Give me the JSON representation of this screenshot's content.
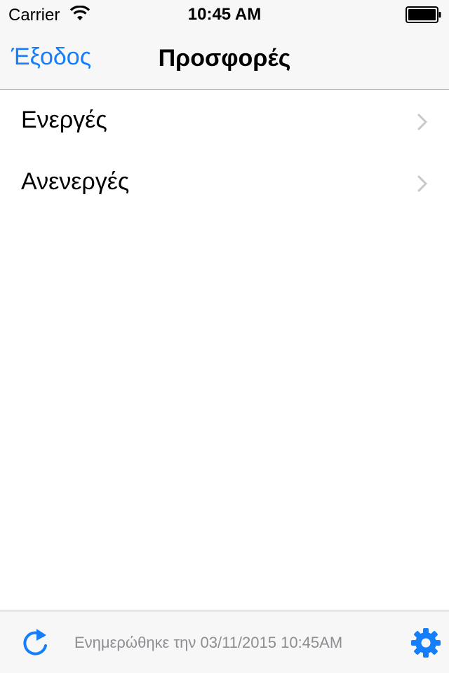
{
  "status_bar": {
    "carrier": "Carrier",
    "time": "10:45 AM",
    "icons": [
      "wifi-icon",
      "battery-icon"
    ]
  },
  "nav": {
    "back_label": "Έξοδος",
    "title": "Προσφορές"
  },
  "list": {
    "items": [
      {
        "label": "Ενεργές",
        "icon": "chevron-right-icon"
      },
      {
        "label": "Ανενεργές",
        "icon": "chevron-right-icon"
      }
    ]
  },
  "toolbar": {
    "updated_text": "Ενημερώθηκε την 03/11/2015 10:45AM",
    "icons": [
      "refresh-icon",
      "gear-icon"
    ]
  },
  "colors": {
    "accent": "#147efb",
    "bar_background": "#f7f7f7",
    "separator": "#b2b2b2",
    "secondary_text": "#8e8e93",
    "chevron": "#c7c7cc"
  }
}
